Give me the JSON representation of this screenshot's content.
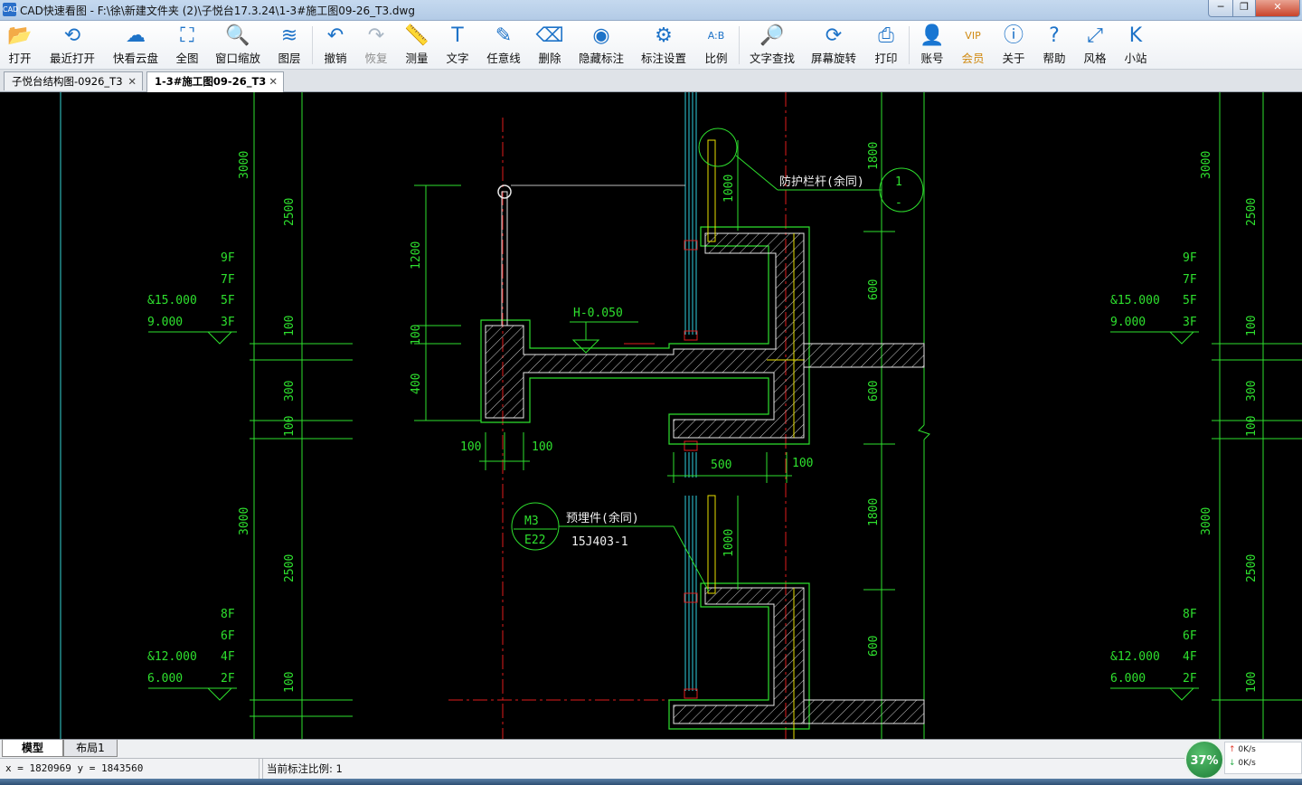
{
  "window": {
    "title": "CAD快速看图 - F:\\徐\\新建文件夹 (2)\\子悦台17.3.24\\1-3#施工图09-26_T3.dwg",
    "app_icon_text": "CAD",
    "min": "─",
    "max": "❐",
    "close": "✕"
  },
  "toolbar": {
    "items": [
      {
        "label": "打开",
        "icon": "folder-open-icon",
        "glyph": "📂"
      },
      {
        "label": "最近打开",
        "icon": "history-icon",
        "glyph": "⟲"
      },
      {
        "label": "快看云盘",
        "icon": "cloud-icon",
        "glyph": "☁"
      },
      {
        "label": "全图",
        "icon": "fit-all-icon",
        "glyph": "⛶"
      },
      {
        "label": "窗口缩放",
        "icon": "zoom-window-icon",
        "glyph": "🔍"
      },
      {
        "label": "图层",
        "icon": "layers-icon",
        "glyph": "≋"
      },
      {
        "label": "撤销",
        "icon": "undo-icon",
        "glyph": "↶"
      },
      {
        "label": "恢复",
        "icon": "redo-icon",
        "glyph": "↷"
      },
      {
        "label": "测量",
        "icon": "ruler-icon",
        "glyph": "📏"
      },
      {
        "label": "文字",
        "icon": "text-icon",
        "glyph": "T"
      },
      {
        "label": "任意线",
        "icon": "pen-icon",
        "glyph": "✎"
      },
      {
        "label": "删除",
        "icon": "eraser-icon",
        "glyph": "⌫"
      },
      {
        "label": "隐藏标注",
        "icon": "eye-hidden-icon",
        "glyph": "◉"
      },
      {
        "label": "标注设置",
        "icon": "settings-icon",
        "glyph": "⚙"
      },
      {
        "label": "比例",
        "icon": "scale-icon",
        "glyph": "A:B"
      },
      {
        "label": "文字查找",
        "icon": "text-search-icon",
        "glyph": "🔎"
      },
      {
        "label": "屏幕旋转",
        "icon": "rotate-screen-icon",
        "glyph": "⟳"
      },
      {
        "label": "打印",
        "icon": "printer-icon",
        "glyph": "⎙"
      },
      {
        "label": "账号",
        "icon": "user-icon",
        "glyph": "👤"
      },
      {
        "label": "会员",
        "icon": "vip-icon",
        "glyph": "VIP"
      },
      {
        "label": "关于",
        "icon": "info-icon",
        "glyph": "ⓘ"
      },
      {
        "label": "帮助",
        "icon": "help-icon",
        "glyph": "?"
      },
      {
        "label": "风格",
        "icon": "style-icon",
        "glyph": "⤢"
      },
      {
        "label": "小站",
        "icon": "site-icon",
        "glyph": "K"
      }
    ]
  },
  "tabs": [
    {
      "label": "子悦台结构图-0926_T3",
      "close": "✕"
    },
    {
      "label": "1-3#施工图09-26_T3",
      "close": "✕"
    }
  ],
  "drawing": {
    "left": {
      "dims_upper": [
        "3000",
        "2500",
        "100",
        "300",
        "100"
      ],
      "dims_lower": [
        "3000",
        "2500",
        "100"
      ],
      "floors_upper": [
        "9F",
        "7F",
        "5F",
        "3F"
      ],
      "floors_lower": [
        "8F",
        "6F",
        "4F",
        "2F"
      ],
      "elev_upper": [
        "&15.000",
        "9.000"
      ],
      "elev_lower": [
        "&12.000",
        "6.000"
      ]
    },
    "center": {
      "dim_1200": "1200",
      "dim_100a": "100",
      "dim_400": "400",
      "dim_100_left": "100",
      "dim_100_right": "100",
      "dim_500": "500",
      "dim_100b": "100",
      "dim_1000_upper": "1000",
      "dim_1000_lower": "1000",
      "level_mark": "H-0.050",
      "guardrail_note": "防护栏杆(余同)",
      "detail_num": "1",
      "detail_sheet": "-",
      "embed_note": "预埋件(余同)",
      "embed_ref": "15J403-1",
      "m3": "M3",
      "e22": "E22"
    },
    "right_dims": [
      "1800",
      "600",
      "600",
      "1800",
      "600"
    ]
  },
  "layout_tabs": [
    "模型",
    "布局1"
  ],
  "status": {
    "coords": "x = 1820969  y = 1843560",
    "scale_label": "当前标注比例: 1"
  },
  "net": {
    "percent": "37%",
    "up": "0K/s",
    "down": "0K/s"
  }
}
